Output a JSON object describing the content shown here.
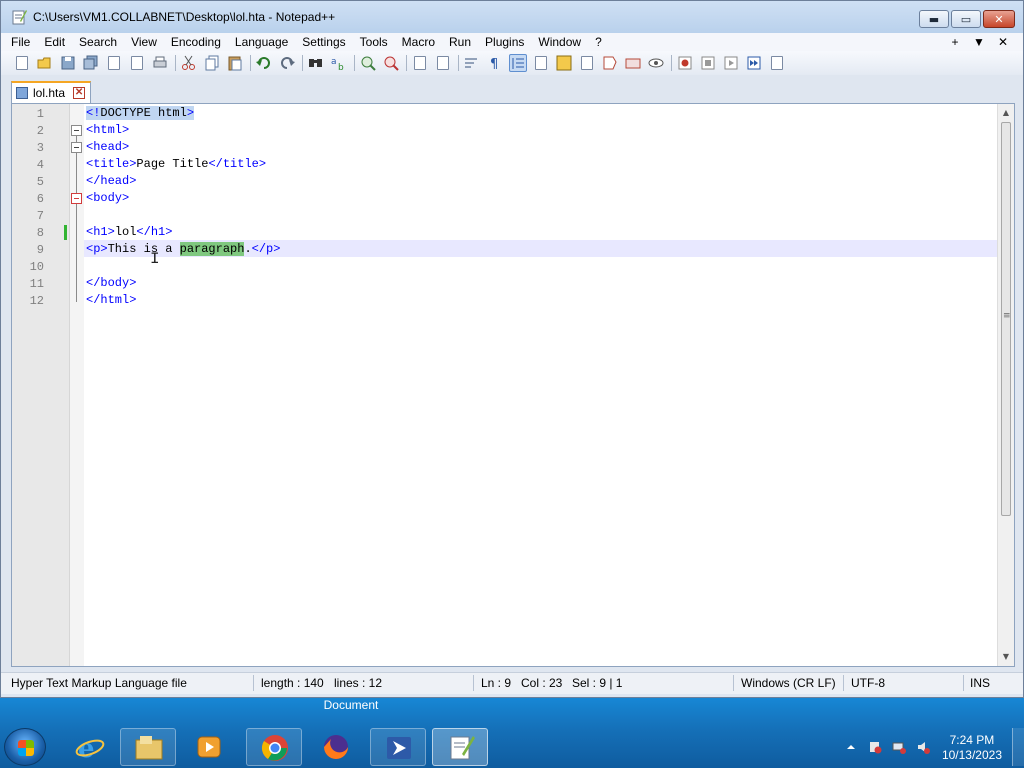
{
  "window": {
    "title": "C:\\Users\\VM1.COLLABNET\\Desktop\\lol.hta - Notepad++",
    "minimize": "▬",
    "maximize": "▭",
    "close": "✕"
  },
  "menu": {
    "items": [
      "File",
      "Edit",
      "Search",
      "View",
      "Encoding",
      "Language",
      "Settings",
      "Tools",
      "Macro",
      "Run",
      "Plugins",
      "Window",
      "?"
    ],
    "right": [
      "+",
      "▼",
      "✕"
    ]
  },
  "tab": {
    "label": "lol.hta",
    "close": "✕"
  },
  "editor": {
    "line_numbers": [
      "1",
      "2",
      "3",
      "4",
      "5",
      "6",
      "7",
      "8",
      "9",
      "10",
      "11",
      "12"
    ],
    "current_line": 9
  },
  "status": {
    "file_type": "Hyper Text Markup Language file",
    "length": "length : 140",
    "lines": "lines : 12",
    "ln": "Ln : 9",
    "col": "Col : 23",
    "sel": "Sel : 9 | 1",
    "eol": "Windows (CR LF)",
    "encoding": "UTF-8",
    "mode": "INS"
  },
  "taskbar": {
    "tooltip": "Document",
    "time": "7:24 PM",
    "date": "10/13/2023"
  },
  "icons": {
    "app": "notepad-icon",
    "start": "windows-logo-icon"
  }
}
